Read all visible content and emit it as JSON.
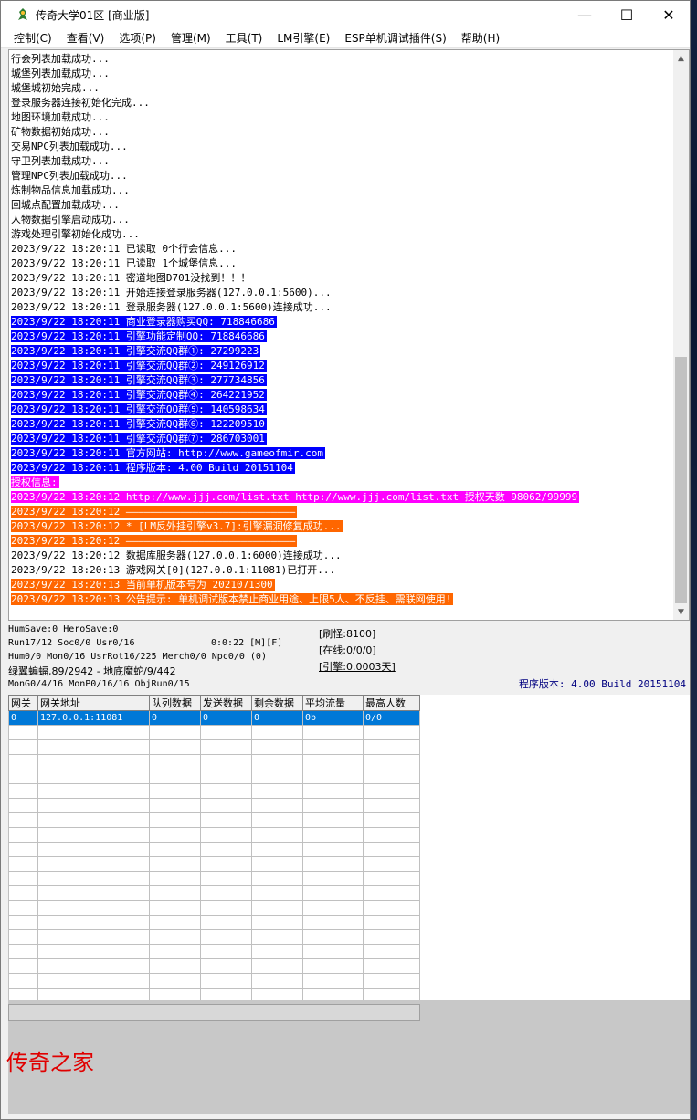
{
  "window": {
    "title": "传奇大学01区 [商业版]",
    "controls": {
      "minimize": "—",
      "maximize": "☐",
      "close": "✕"
    }
  },
  "menu": [
    "控制(C)",
    "查看(V)",
    "选项(P)",
    "管理(M)",
    "工具(T)",
    "LM引擎(E)",
    "ESP单机调试插件(S)",
    "帮助(H)"
  ],
  "log": [
    {
      "text": "行会列表加载成功...",
      "hl": ""
    },
    {
      "text": "城堡列表加载成功...",
      "hl": ""
    },
    {
      "text": "城堡城初始完成...",
      "hl": ""
    },
    {
      "text": "登录服务器连接初始化完成...",
      "hl": ""
    },
    {
      "text": "地图环境加载成功...",
      "hl": ""
    },
    {
      "text": "矿物数据初始成功...",
      "hl": ""
    },
    {
      "text": "交易NPC列表加载成功...",
      "hl": ""
    },
    {
      "text": "守卫列表加载成功...",
      "hl": ""
    },
    {
      "text": "管理NPC列表加载成功...",
      "hl": ""
    },
    {
      "text": "炼制物品信息加载成功...",
      "hl": ""
    },
    {
      "text": "回城点配置加载成功...",
      "hl": ""
    },
    {
      "text": "人物数据引擎启动成功...",
      "hl": ""
    },
    {
      "text": "游戏处理引擎初始化成功...",
      "hl": ""
    },
    {
      "text": "2023/9/22 18:20:11 已读取 0个行会信息...",
      "hl": ""
    },
    {
      "text": "2023/9/22 18:20:11 已读取 1个城堡信息...",
      "hl": ""
    },
    {
      "text": "2023/9/22 18:20:11 密道地图D701没找到！！！",
      "hl": ""
    },
    {
      "text": "2023/9/22 18:20:11 开始连接登录服务器(127.0.0.1:5600)...",
      "hl": ""
    },
    {
      "text": "2023/9/22 18:20:11 登录服务器(127.0.0.1:5600)连接成功...",
      "hl": ""
    },
    {
      "text": "2023/9/22 18:20:11 商业登录器购买QQ: 718846686",
      "hl": "blue"
    },
    {
      "text": "2023/9/22 18:20:11 引擎功能定制QQ: 718846686",
      "hl": "blue"
    },
    {
      "text": "2023/9/22 18:20:11 引擎交流QQ群①: 27299223",
      "hl": "blue"
    },
    {
      "text": "2023/9/22 18:20:11 引擎交流QQ群②: 249126912",
      "hl": "blue"
    },
    {
      "text": "2023/9/22 18:20:11 引擎交流QQ群③: 277734856",
      "hl": "blue"
    },
    {
      "text": "2023/9/22 18:20:11 引擎交流QQ群④: 264221952",
      "hl": "blue"
    },
    {
      "text": "2023/9/22 18:20:11 引擎交流QQ群⑤: 140598634",
      "hl": "blue"
    },
    {
      "text": "2023/9/22 18:20:11 引擎交流QQ群⑥: 122209510",
      "hl": "blue"
    },
    {
      "text": "2023/9/22 18:20:11 引擎交流QQ群⑦: 286703001",
      "hl": "blue"
    },
    {
      "text": "2023/9/22 18:20:11 官方网站: http://www.gameofmir.com",
      "hl": "blue"
    },
    {
      "text": "2023/9/22 18:20:11 程序版本: 4.00 Build 20151104",
      "hl": "blue"
    },
    {
      "text": "授权信息:",
      "hl": "magenta"
    },
    {
      "text": "2023/9/22 18:20:12 http://www.jjj.com/list.txt http://www.jjj.com/list.txt 授权天数 98062/99999",
      "hl": "magenta"
    },
    {
      "text": "2023/9/22 18:20:12 ————————————————————————————",
      "hl": "orange"
    },
    {
      "text": "2023/9/22 18:20:12 * [LM反外挂引擎v3.7]:引擎漏洞修复成功...",
      "hl": "orange"
    },
    {
      "text": "2023/9/22 18:20:12 ————————————————————————————",
      "hl": "orange"
    },
    {
      "text": "2023/9/22 18:20:12 数据库服务器(127.0.0.1:6000)连接成功...",
      "hl": ""
    },
    {
      "text": "2023/9/22 18:20:13 游戏网关[0](127.0.0.1:11081)已打开...",
      "hl": ""
    },
    {
      "text": "2023/9/22 18:20:13 当前单机版本号为 2021071300",
      "hl": "orange"
    },
    {
      "text": "2023/9/22 18:20:13 公告提示: 单机调试版本禁止商业用途、上限5人、不反挂、需联网使用!",
      "hl": "orange"
    }
  ],
  "status": {
    "line1": "HumSave:0 HeroSave:0",
    "line2": "Run17/12 Soc0/0 Usr0/16",
    "timer": "0:0:22 [M][F]",
    "line3": "Hum0/0 Mon0/16 UsrRot16/225 Merch0/0 Npc0/0 (0)",
    "line4": "绿翼蝙蝠,89/2942 - 地底魔蛇/9/442",
    "line5": "MonG0/4/16 MonP0/16/16 ObjRun0/15",
    "refresh": "[刷怪:8100]",
    "online": "[在线:0/0/0]",
    "engine": "[引擎:0.0003天]",
    "version": "程序版本: 4.00 Build 20151104"
  },
  "gateway_table": {
    "columns": [
      "网关",
      "网关地址",
      "队列数据",
      "发送数据",
      "剩余数据",
      "平均流量",
      "最高人数"
    ],
    "rows": [
      [
        "0",
        "127.0.0.1:11081",
        "0",
        "0",
        "0",
        "0b",
        "0/0"
      ]
    ],
    "empty_rows": 19
  },
  "watermark": "传奇之家",
  "colors": {
    "hl_blue": "#0000ff",
    "hl_magenta": "#ff00ff",
    "hl_orange": "#ff6600",
    "selected_row": "#0078d7"
  }
}
